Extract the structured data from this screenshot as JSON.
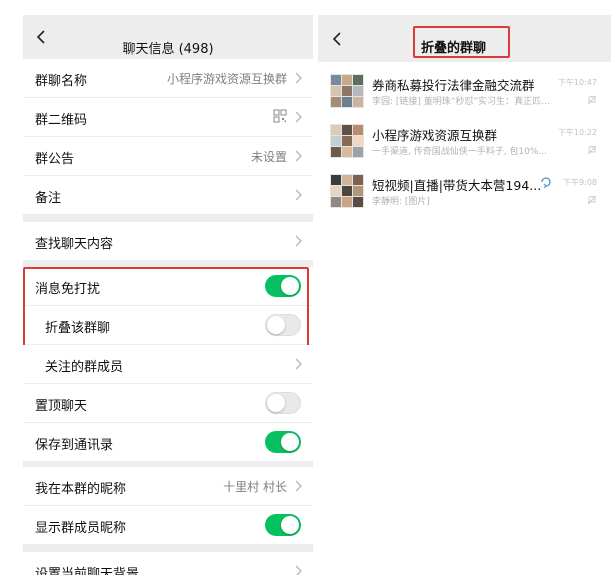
{
  "colors": {
    "accent": "#07c160",
    "highlight": "#d93b3b",
    "background": "#ededed"
  },
  "left": {
    "title": "聊天信息 (498)",
    "group_name": {
      "label": "群聊名称",
      "value": "小程序游戏资源互换群"
    },
    "qr_code": {
      "label": "群二维码",
      "icon": "qr-code-icon"
    },
    "announcement": {
      "label": "群公告",
      "value": "未设置"
    },
    "remark": {
      "label": "备注"
    },
    "search_history": {
      "label": "查找聊天内容"
    },
    "mute": {
      "label": "消息免打扰",
      "on": true
    },
    "fold": {
      "label": "折叠该群聊",
      "on": false
    },
    "followed_members": {
      "label": "关注的群成员"
    },
    "pin": {
      "label": "置顶聊天",
      "on": false
    },
    "save_contacts": {
      "label": "保存到通讯录",
      "on": true
    },
    "my_nickname": {
      "label": "我在本群的昵称",
      "value": "十里村 村长"
    },
    "show_nicknames": {
      "label": "显示群成员昵称",
      "on": true
    },
    "background": {
      "label": "设置当前聊天背景"
    }
  },
  "right": {
    "title": "折叠的群聊",
    "chats": [
      {
        "name": "券商私募投行法律金融交流群",
        "message": "李园: [链接] 董明珠“秒怼”实习生：真正匹...",
        "time": "下午10:47"
      },
      {
        "name": "小程序游戏资源互换群",
        "message": "一手渠道, 传奇国战仙侠一手料子, 包10%...",
        "time": "下午10:22"
      },
      {
        "name": "短视频|直播|带货大本营194...",
        "message": "李靜明: [图片]",
        "time": "下午9:08"
      }
    ]
  }
}
